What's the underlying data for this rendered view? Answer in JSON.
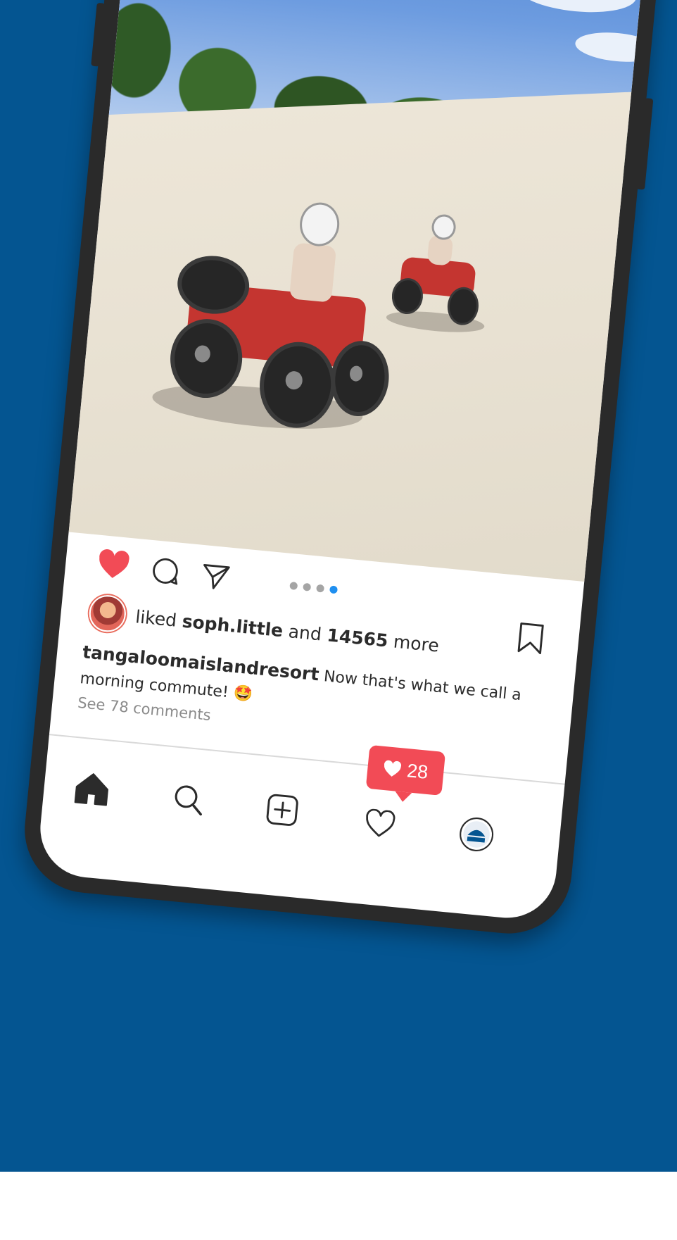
{
  "post": {
    "liked_prefix": "liked",
    "liked_user": "soph.little",
    "liked_and": "and",
    "like_count": "14565",
    "liked_suffix": "more",
    "author": "tangaloomaislandresort",
    "caption": "Now that's what we call a morning commute! 🤩",
    "comments_link": "See 78 comments",
    "carousel": {
      "total": 4,
      "active_index": 3
    }
  },
  "notifications": {
    "likes_badge": "28"
  },
  "icons": {
    "like": "heart-filled-icon",
    "comment": "speech-bubble-icon",
    "share": "paper-plane-icon",
    "save": "bookmark-icon",
    "home": "home-icon",
    "search": "search-icon",
    "create": "plus-square-icon",
    "activity": "heart-outline-icon",
    "profile": "profile-avatar-icon"
  },
  "colors": {
    "background": "#045591",
    "like_red": "#f24b56",
    "active_dot": "#1f8ff0"
  }
}
